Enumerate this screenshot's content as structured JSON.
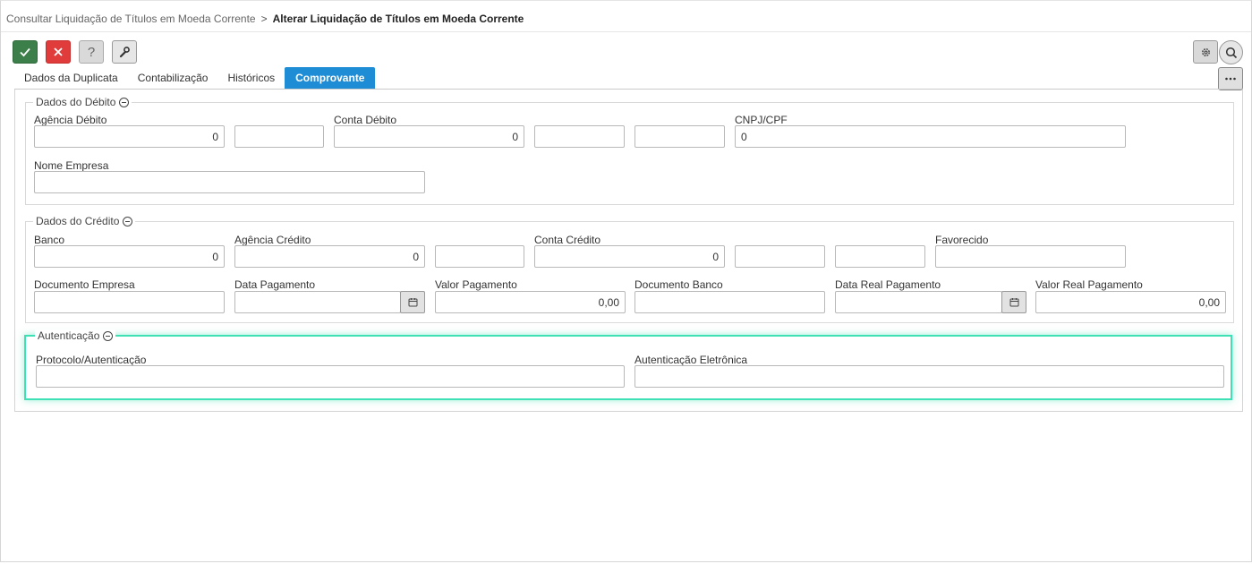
{
  "breadcrumb": {
    "parent": "Consultar Liquidação de Títulos em Moeda Corrente",
    "separator": ">",
    "current": "Alterar Liquidação de Títulos em Moeda Corrente"
  },
  "toolbar": {
    "confirm_icon": "check-icon",
    "cancel_icon": "close-icon",
    "help_label": "?",
    "tools_icon": "wrench-icon",
    "settings_icon": "gear-icon",
    "search_icon": "search-icon",
    "more_icon": "more-horizontal-icon"
  },
  "tabs": [
    {
      "label": "Dados da Duplicata",
      "active": false
    },
    {
      "label": "Contabilização",
      "active": false
    },
    {
      "label": "Históricos",
      "active": false
    },
    {
      "label": "Comprovante",
      "active": true
    }
  ],
  "debito": {
    "legend": "Dados do Débito",
    "agencia_label": "Agência Débito",
    "agencia_value": "0",
    "agencia_dv_value": "",
    "conta_label": "Conta Débito",
    "conta_value": "0",
    "conta_dv_value": "",
    "conta_extra_value": "",
    "cnpj_label": "CNPJ/CPF",
    "cnpj_value": "0",
    "nome_label": "Nome Empresa",
    "nome_value": ""
  },
  "credito": {
    "legend": "Dados do Crédito",
    "banco_label": "Banco",
    "banco_value": "0",
    "agencia_label": "Agência Crédito",
    "agencia_value": "0",
    "agencia_dv_value": "",
    "conta_label": "Conta Crédito",
    "conta_value": "0",
    "conta_dv_value": "",
    "conta_extra_value": "",
    "favorecido_label": "Favorecido",
    "favorecido_value": "",
    "doc_empresa_label": "Documento Empresa",
    "doc_empresa_value": "",
    "data_pag_label": "Data Pagamento",
    "data_pag_value": "",
    "valor_pag_label": "Valor Pagamento",
    "valor_pag_value": "0,00",
    "doc_banco_label": "Documento Banco",
    "doc_banco_value": "",
    "data_real_label": "Data Real Pagamento",
    "data_real_value": "",
    "valor_real_label": "Valor Real Pagamento",
    "valor_real_value": "0,00"
  },
  "autenticacao": {
    "legend": "Autenticação",
    "protocolo_label": "Protocolo/Autenticação",
    "protocolo_value": "",
    "eletronica_label": "Autenticação Eletrônica",
    "eletronica_value": ""
  },
  "colors": {
    "confirm": "#3d7f4a",
    "cancel": "#e03c3c",
    "tab_active": "#1f8dd6",
    "highlight": "#3fe0b4"
  }
}
